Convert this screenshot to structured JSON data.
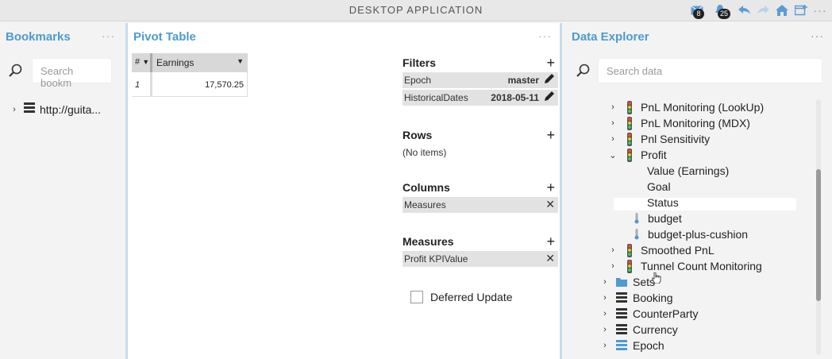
{
  "app": {
    "title": "DESKTOP APPLICATION",
    "notif_mail_count": "8",
    "notif_bell_count": "25"
  },
  "bookmarks": {
    "title": "Bookmarks",
    "menu": "···",
    "search_placeholder": "Search bookm",
    "items": [
      {
        "label": "http://guita..."
      }
    ]
  },
  "pivot": {
    "title": "Pivot Table",
    "menu": "···",
    "grid": {
      "col_num": "#",
      "col_earnings": "Earnings",
      "rows": [
        {
          "num": "1",
          "value": "17,570.25"
        }
      ]
    },
    "filters": {
      "label": "Filters",
      "items": [
        {
          "name": "Epoch",
          "value": "master"
        },
        {
          "name": "HistoricalDates",
          "value": "2018-05-11"
        }
      ]
    },
    "rows": {
      "label": "Rows",
      "empty": "(No items)"
    },
    "columns": {
      "label": "Columns",
      "items": [
        {
          "name": "Measures"
        }
      ]
    },
    "measures": {
      "label": "Measures",
      "items": [
        {
          "name": "Profit KPIValue"
        }
      ]
    },
    "deferred_update": "Deferred Update"
  },
  "explorer": {
    "title": "Data Explorer",
    "menu": "···",
    "search_placeholder": "Search data",
    "tree": [
      {
        "label": "PnL Monitoring (LookUp)",
        "icon": "traffic-light-icon",
        "chevron": "›"
      },
      {
        "label": "PnL Monitoring (MDX)",
        "icon": "traffic-light-icon",
        "chevron": "›"
      },
      {
        "label": "Pnl Sensitivity",
        "icon": "traffic-light-icon",
        "chevron": "›"
      },
      {
        "label": "Profit",
        "icon": "traffic-light-icon",
        "chevron": "⌄"
      },
      {
        "label": "Value (Earnings)"
      },
      {
        "label": "Goal"
      },
      {
        "label": "Status"
      },
      {
        "label": "budget",
        "icon": "thermometer-icon"
      },
      {
        "label": "budget-plus-cushion",
        "icon": "thermometer-icon"
      },
      {
        "label": "Smoothed PnL",
        "icon": "traffic-light-icon",
        "chevron": "›"
      },
      {
        "label": "Tunnel Count Monitoring",
        "icon": "traffic-light-icon",
        "chevron": "›"
      },
      {
        "label": "Sets",
        "icon": "folder-icon",
        "chevron": "›"
      },
      {
        "label": "Booking",
        "icon": "hierarchy-icon",
        "chevron": "›"
      },
      {
        "label": "CounterParty",
        "icon": "hierarchy-icon",
        "chevron": "›"
      },
      {
        "label": "Currency",
        "icon": "hierarchy-icon",
        "chevron": "›"
      },
      {
        "label": "Epoch",
        "icon": "hierarchy-blue-icon",
        "chevron": "›"
      }
    ]
  },
  "colors": {
    "accent": "#4d9bd0",
    "chip_bg": "#e2e2e2",
    "panel_border": "#c7dcea"
  }
}
